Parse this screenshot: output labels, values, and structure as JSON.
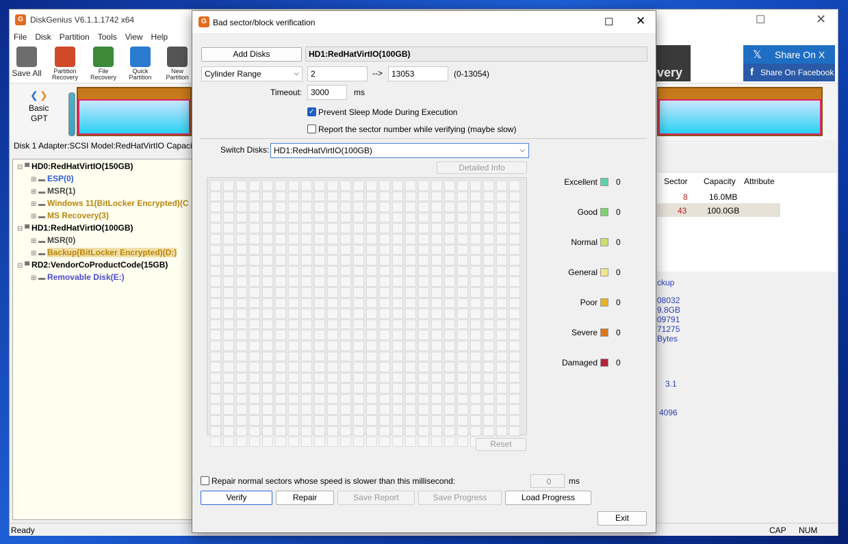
{
  "app": {
    "title": "DiskGenius V6.1.1.1742 x64",
    "menu": [
      "File",
      "Disk",
      "Partition",
      "Tools",
      "View",
      "Help"
    ],
    "toolbar": [
      {
        "label1": "Save All",
        "label2": "",
        "icon": "save-icon"
      },
      {
        "label1": "Partition",
        "label2": "Recovery",
        "icon": "partition-recovery-icon"
      },
      {
        "label1": "File",
        "label2": "Recovery",
        "icon": "file-recovery-icon"
      },
      {
        "label1": "Quick",
        "label2": "Partition",
        "icon": "quick-partition-icon"
      },
      {
        "label1": "New",
        "label2": "Partition",
        "icon": "new-partition-icon"
      }
    ],
    "share_x": "Share On X",
    "share_fb": "Share On Facebook",
    "banner_text": "overy",
    "disk_nav": {
      "line1": "Basic",
      "line2": "GPT"
    },
    "disk_info": "Disk 1 Adapter:SCSI  Model:RedHatVirtIO  Capacit",
    "tree": [
      {
        "text": "HD0:RedHatVirtIO(150GB)",
        "level": 0,
        "color": "#000",
        "bold": true
      },
      {
        "text": "ESP(0)",
        "level": 1,
        "color": "#2a5bd7",
        "bold": true
      },
      {
        "text": "MSR(1)",
        "level": 1,
        "color": "#444",
        "bold": true
      },
      {
        "text": "Windows 11(BitLocker Encrypted)(C",
        "level": 1,
        "color": "#b8860b",
        "bold": true
      },
      {
        "text": "MS Recovery(3)",
        "level": 1,
        "color": "#b8860b",
        "bold": true
      },
      {
        "text": "HD1:RedHatVirtIO(100GB)",
        "level": 0,
        "color": "#000",
        "bold": true
      },
      {
        "text": "MSR(0)",
        "level": 1,
        "color": "#444",
        "bold": true
      },
      {
        "text": "Backup(BitLocker Encrypted)(D:)",
        "level": 1,
        "color": "#b8860b",
        "bold": true
      },
      {
        "text": "RD2:VendorCoProductCode(15GB)",
        "level": 0,
        "color": "#000",
        "bold": true
      },
      {
        "text": "Removable Disk(E:)",
        "level": 1,
        "color": "#4a4ad0",
        "bold": true
      }
    ],
    "right_table": {
      "headers": [
        "Sector",
        "Capacity",
        "Attribute"
      ],
      "rows": [
        [
          "8",
          "16.0MB",
          ""
        ],
        [
          "43",
          "100.0GB",
          ""
        ]
      ]
    },
    "right_info": {
      "label": "ckup",
      "values": [
        "08032",
        "9.8GB",
        "09791",
        "71275",
        "Bytes"
      ],
      "v2": "3.1",
      "v3": "4096"
    },
    "status": {
      "ready": "Ready",
      "cap": "CAP",
      "num": "NUM"
    }
  },
  "dialog": {
    "title": "Bad sector/block verification",
    "add_disks": "Add Disks",
    "disk_name": "HD1:RedHatVirtIO(100GB)",
    "range_mode": "Cylinder Range",
    "range_from": "2",
    "arrow": "-->",
    "range_to": "13053",
    "range_hint": "(0-13054)",
    "timeout_label": "Timeout:",
    "timeout_value": "3000",
    "timeout_unit": "ms",
    "prevent_sleep": "Prevent Sleep Mode During Execution",
    "report_sector": "Report the sector number while verifying (maybe slow)",
    "switch_label": "Switch Disks:",
    "switch_value": "HD1:RedHatVirtIO(100GB)",
    "detailed_info": "Detailed Info",
    "legend": [
      {
        "label": "Excellent",
        "color": "#5fd3a8",
        "count": "0"
      },
      {
        "label": "Good",
        "color": "#7dd36b",
        "count": "0"
      },
      {
        "label": "Normal",
        "color": "#c8e06a",
        "count": "0"
      },
      {
        "label": "General",
        "color": "#f3e58a",
        "count": "0"
      },
      {
        "label": "Poor",
        "color": "#e9b22a",
        "count": "0"
      },
      {
        "label": "Severe",
        "color": "#d9761c",
        "count": "0"
      },
      {
        "label": "Damaged",
        "color": "#b3243a",
        "count": "0"
      }
    ],
    "reset": "Reset",
    "repair_slow": "Repair normal sectors whose speed is slower than this millisecond:",
    "repair_ms": "0",
    "repair_unit": "ms",
    "verify": "Verify",
    "repair": "Repair",
    "save_report": "Save Report",
    "save_progress": "Save Progress",
    "load_progress": "Load Progress",
    "exit": "Exit"
  }
}
